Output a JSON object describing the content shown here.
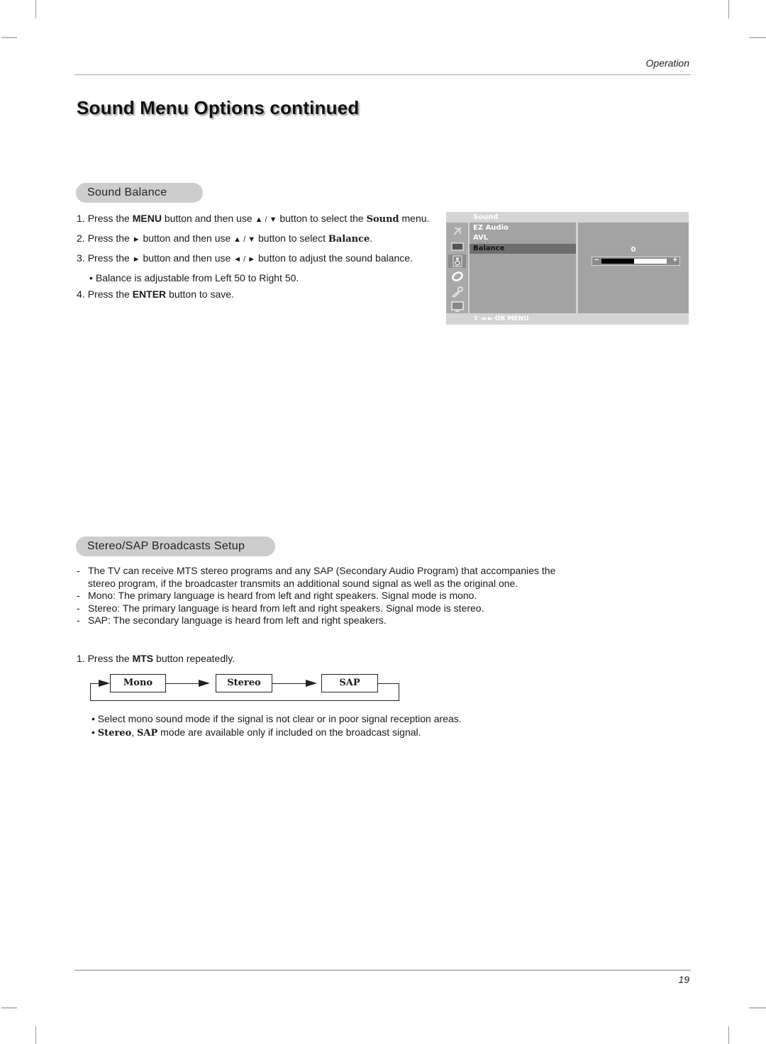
{
  "header": {
    "section_label": "Operation"
  },
  "page_title": "Sound Menu Options continued",
  "sound_balance": {
    "heading": "Sound Balance",
    "steps": [
      {
        "num": "1.",
        "parts": [
          {
            "t": "Press the ",
            "s": "n"
          },
          {
            "t": "MENU",
            "s": "b"
          },
          {
            "t": " button and then use ",
            "s": "n"
          },
          {
            "t": "▲ / ▼",
            "s": "g"
          },
          {
            "t": "  button to select the ",
            "s": "n"
          },
          {
            "t": "Sound",
            "s": "bs"
          },
          {
            "t": " menu.",
            "s": "n"
          }
        ]
      },
      {
        "num": "2.",
        "parts": [
          {
            "t": "Press the ",
            "s": "n"
          },
          {
            "t": "►",
            "s": "g"
          },
          {
            "t": "  button and then use ",
            "s": "n"
          },
          {
            "t": "▲ / ▼",
            "s": "g"
          },
          {
            "t": " button to select ",
            "s": "n"
          },
          {
            "t": "Balance",
            "s": "bs"
          },
          {
            "t": ".",
            "s": "n"
          }
        ]
      },
      {
        "num": "3.",
        "parts": [
          {
            "t": "Press the ",
            "s": "n"
          },
          {
            "t": "►",
            "s": "g"
          },
          {
            "t": "  button and then use ",
            "s": "n"
          },
          {
            "t": "◄ / ►",
            "s": "g"
          },
          {
            "t": " button to adjust the sound balance.",
            "s": "n"
          }
        ]
      },
      {
        "num": "•",
        "indent": true,
        "parts": [
          {
            "t": "Balance is adjustable from Left 50 to Right 50.",
            "s": "n"
          }
        ]
      },
      {
        "num": "4.",
        "parts": [
          {
            "t": "Press the ",
            "s": "n"
          },
          {
            "t": "ENTER",
            "s": "b"
          },
          {
            "t": " button to save.",
            "s": "n"
          }
        ]
      }
    ],
    "osd": {
      "title": "Sound",
      "icons": [
        "satellite-dish-icon",
        "picture-icon",
        "speaker-icon",
        "time-icon",
        "key-lock-icon",
        "pc-monitor-icon"
      ],
      "active_icon_index": 2,
      "items": [
        "EZ Audio",
        "AVL",
        "Balance"
      ],
      "selected_item": "Balance",
      "value": "0",
      "minus_label": "−",
      "plus_label": "+",
      "balance_fill_fraction": 0.5,
      "footer": "◄ ► OK   MENU",
      "footer_updown": "⇕",
      "colors": {
        "bg": "#d4d4d4",
        "panel": "#a3a3a3",
        "selected": "#6e6e6e"
      }
    }
  },
  "stereo_sap": {
    "heading": "Stereo/SAP Broadcasts Setup",
    "descriptions": [
      "The TV can receive MTS stereo programs and any SAP (Secondary Audio Program) that accompanies the",
      "stereo program, if the broadcaster transmits an additional sound signal as well as the original one.",
      "Mono: The primary language is heard from left and right speakers. Signal mode is mono.",
      "Stereo: The primary language is heard from left and right speakers. Signal mode is stereo.",
      "SAP: The secondary language is heard from left and right speakers."
    ],
    "step1": {
      "prefix": "1. Press the ",
      "bold": "MTS",
      "suffix": " button repeatedly."
    },
    "flow": [
      "Mono",
      "Stereo",
      "SAP"
    ],
    "notes": {
      "note1": "Select mono sound mode if the signal is not clear or in poor signal reception areas.",
      "note2_bold1": "Stereo",
      "note2_sep": ", ",
      "note2_bold2": "SAP",
      "note2_rest": " mode are available only if included on the broadcast signal."
    }
  },
  "footer": {
    "page_number": "19"
  }
}
